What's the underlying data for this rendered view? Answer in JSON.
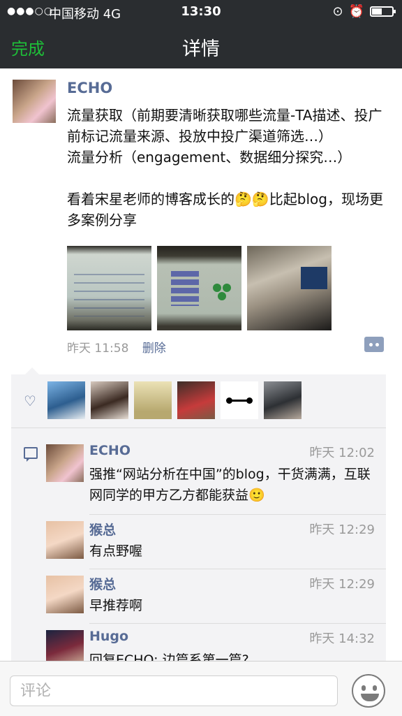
{
  "status_bar": {
    "signal": "●●●○○",
    "carrier": "中国移动 4G",
    "time": "13:30"
  },
  "nav": {
    "done_label": "完成",
    "title": "详情"
  },
  "post": {
    "author": "ECHO",
    "lines": [
      "流量获取（前期要清晰获取哪些流量-TA描述、投广前标记流量来源、投放中投广渠道筛选…）",
      "流量分析（engagement、数据细分探究…）",
      "",
      "看着宋星老师的博客成长的🤔🤔比起blog，现场更多案例分享"
    ],
    "photo_count": 3,
    "time": "昨天 11:58",
    "delete_label": "删除"
  },
  "likes": {
    "count": 6
  },
  "comments": [
    {
      "name": "ECHO",
      "time": "昨天 12:02",
      "text": "强推“网站分析在中国”的blog，干货满满，互联网同学的甲方乙方都能获益🙂"
    },
    {
      "name": "猴总",
      "time": "昨天 12:29",
      "text": "有点野喔"
    },
    {
      "name": "猴总",
      "time": "昨天 12:29",
      "text": "早推荐啊"
    },
    {
      "name": "Hugo",
      "time": "昨天 14:32",
      "text": "回复ECHO: 边篇系第一篇?"
    }
  ],
  "input": {
    "placeholder": "评论"
  },
  "colors": {
    "accent_green": "#1ebf38",
    "link_blue": "#576b95",
    "bar_dark": "#2a2d30"
  }
}
